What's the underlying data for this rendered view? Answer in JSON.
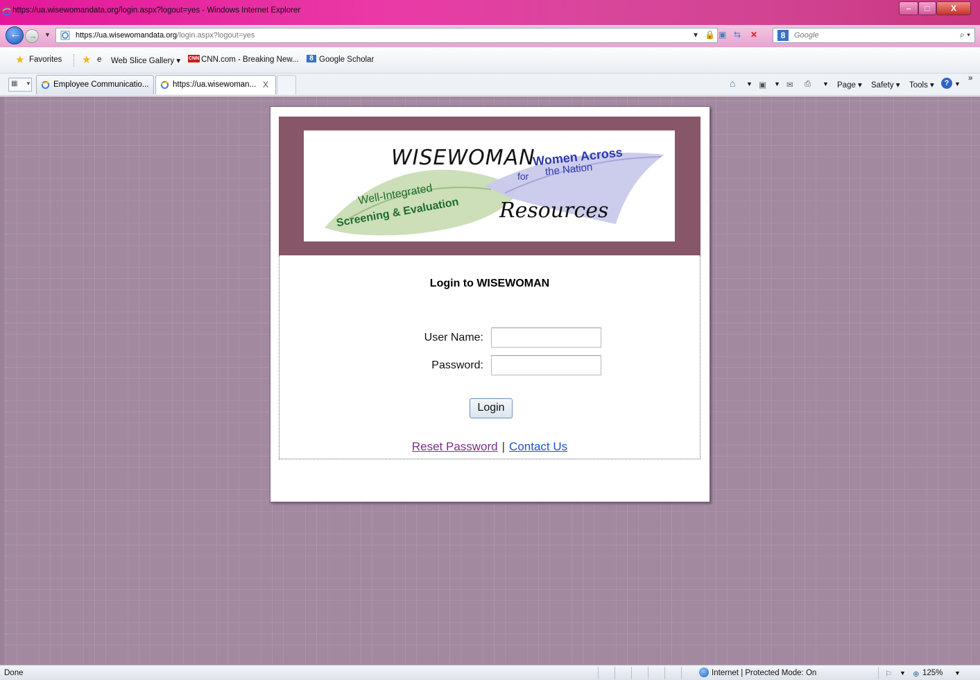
{
  "window": {
    "title": "https://ua.wisewomandata.org/login.aspx?logout=yes - Windows Internet Explorer",
    "controls": {
      "minimize": "–",
      "maximize": "□",
      "close": "X"
    }
  },
  "address_bar": {
    "url_host": "https://ua.wisewomandata.org",
    "url_path": "/login.aspx?logout=yes",
    "search_placeholder": "Google",
    "search_engine_badge": "8"
  },
  "favorites_bar": {
    "favorites_label": "Favorites",
    "items": [
      "Web Slice Gallery ▾",
      "CNN.com - Breaking New...",
      "Google Scholar"
    ],
    "cnn_badge": "CNN",
    "scholar_badge": "8"
  },
  "tabs": {
    "items": [
      {
        "label": "Employee Communicatio...",
        "active": false
      },
      {
        "label": "https://ua.wisewoman...",
        "active": true,
        "close": "X"
      }
    ],
    "commands": [
      "Page ▾",
      "Safety ▾",
      "Tools ▾"
    ],
    "overflow": "»"
  },
  "logo": {
    "brand": "WISEWOMAN",
    "line_left_1": "Well-Integrated",
    "line_left_2": "Screening & Evaluation",
    "line_right_1": "Women Across",
    "line_right_2": "the Nation",
    "for_word": "for",
    "resources": "Resources"
  },
  "login": {
    "title": "Login to WISEWOMAN",
    "username_label": "User Name:",
    "username_value": "",
    "password_label": "Password:",
    "password_value": "",
    "button_label": "Login",
    "reset_link": "Reset Password",
    "link_separator": "|",
    "contact_link": "Contact Us"
  },
  "status_bar": {
    "left_text": "Done",
    "zone_text": "Internet | Protected Mode: On",
    "zoom": "125%"
  },
  "colors": {
    "title_bar": "#e4179a",
    "page_background": "#a2899f",
    "banner_background": "#875668",
    "visited_link": "#7b2c8e",
    "link": "#1a52c3"
  }
}
